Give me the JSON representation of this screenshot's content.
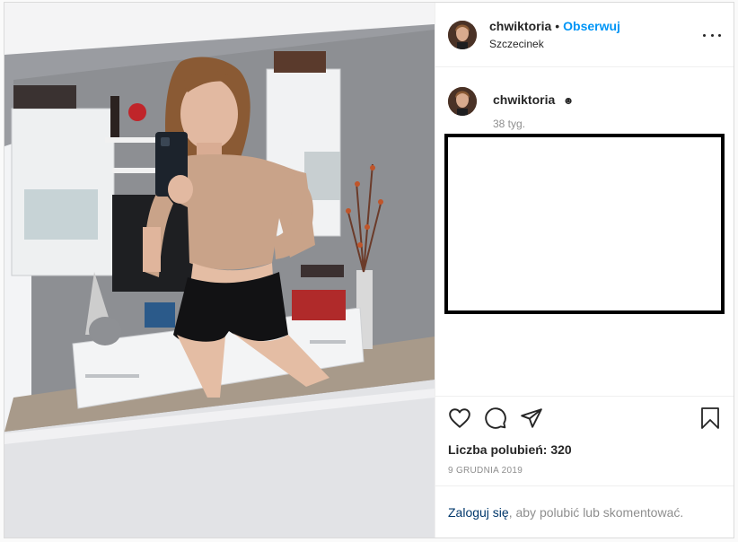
{
  "post": {
    "username": "chwiktoria",
    "follow_label": "Obserwuj",
    "separator": "•",
    "location": "Szczecinek"
  },
  "caption": {
    "username": "chwiktoria",
    "emoji": "☻",
    "time_ago": "38 tyg."
  },
  "icons": {
    "like": "heart-icon",
    "comment": "comment-icon",
    "share": "paper-plane-icon",
    "save": "bookmark-icon",
    "more": "more-options-icon"
  },
  "likes_text": "Liczba polubień: 320",
  "date_text": "9 GRUDNIA 2019",
  "login": {
    "link": "Zaloguj się",
    "rest": ", aby polubić lub skomentować."
  },
  "colors": {
    "accent": "#0095f6",
    "link_dark": "#00376b",
    "muted": "#8e8e8e",
    "text": "#262626"
  }
}
